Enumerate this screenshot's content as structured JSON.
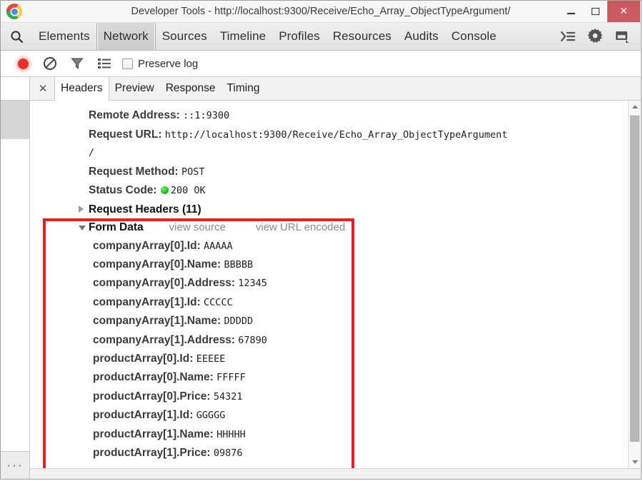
{
  "window": {
    "title": "Developer Tools - http://localhost:9300/Receive/Echo_Array_ObjectTypeArgument/",
    "minimize_label": "–",
    "maximize_label": "",
    "close_label": "✕",
    "accent_red": "#cb5a5e",
    "annotation_color": "#ed1c24"
  },
  "panel_tabs": {
    "search_icon": "search-icon",
    "items": [
      {
        "label": "Elements",
        "active": false
      },
      {
        "label": "Network",
        "active": true
      },
      {
        "label": "Sources",
        "active": false
      },
      {
        "label": "Timeline",
        "active": false
      },
      {
        "label": "Profiles",
        "active": false
      },
      {
        "label": "Resources",
        "active": false
      },
      {
        "label": "Audits",
        "active": false
      },
      {
        "label": "Console",
        "active": false
      }
    ],
    "right_icons": [
      {
        "name": "console-drawer-icon"
      },
      {
        "name": "gear-icon"
      },
      {
        "name": "dock-position-icon"
      }
    ]
  },
  "network_toolbar": {
    "record_icon": "record-icon",
    "clear_icon": "clear-icon",
    "filter_icon": "filter-icon",
    "list_view_icon": "list-view-icon",
    "preserve_log_label": "Preserve log",
    "preserve_log_checked": false
  },
  "left_rail": {
    "overflow_label": "···"
  },
  "sub_tabs": {
    "close_label": "✕",
    "items": [
      {
        "label": "Headers",
        "active": true
      },
      {
        "label": "Preview",
        "active": false
      },
      {
        "label": "Response",
        "active": false
      },
      {
        "label": "Timing",
        "active": false
      }
    ]
  },
  "headers": {
    "remote_address_key": "Remote Address:",
    "remote_address_value": "::1:9300",
    "request_url_key": "Request URL:",
    "request_url_value": "http://localhost:9300/Receive/Echo_Array_ObjectTypeArgument",
    "request_url_wrap": "/",
    "request_method_key": "Request Method:",
    "request_method_value": "POST",
    "status_code_key": "Status Code:",
    "status_code_value": "200  OK",
    "status_dot_color": "#13bd12",
    "request_headers_label": "Request Headers (11)",
    "request_headers_expanded": false,
    "form_data_label": "Form Data",
    "form_data_expanded": true,
    "view_source_label": "view source",
    "view_url_encoded_label": "view URL encoded"
  },
  "form_data": [
    {
      "key": "companyArray[0].Id:",
      "value": "AAAAA"
    },
    {
      "key": "companyArray[0].Name:",
      "value": "BBBBB"
    },
    {
      "key": "companyArray[0].Address:",
      "value": "12345"
    },
    {
      "key": "companyArray[1].Id:",
      "value": "CCCCC"
    },
    {
      "key": "companyArray[1].Name:",
      "value": "DDDDD"
    },
    {
      "key": "companyArray[1].Address:",
      "value": "67890"
    },
    {
      "key": "productArray[0].Id:",
      "value": "EEEEE"
    },
    {
      "key": "productArray[0].Name:",
      "value": "FFFFF"
    },
    {
      "key": "productArray[0].Price:",
      "value": "54321"
    },
    {
      "key": "productArray[1].Id:",
      "value": "GGGGG"
    },
    {
      "key": "productArray[1].Name:",
      "value": "HHHHH"
    },
    {
      "key": "productArray[1].Price:",
      "value": "09876"
    }
  ]
}
